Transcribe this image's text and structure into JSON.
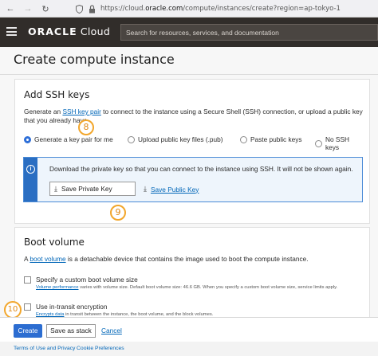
{
  "browser": {
    "url_prefix": "https://cloud.",
    "url_host": "oracle.com",
    "url_path": "/compute/instances/create?region=ap-tokyo-1"
  },
  "header": {
    "logo_bold": "ORACLE",
    "logo_light": " Cloud",
    "search_placeholder": "Search for resources, services, and documentation"
  },
  "page": {
    "title": "Create compute instance"
  },
  "ssh": {
    "title": "Add SSH keys",
    "desc_before": "Generate an ",
    "desc_link": "SSH key pair",
    "desc_after": " to connect to the instance using a Secure Shell (SSH) connection, or upload a public key that you already have.",
    "options": [
      {
        "label": "Generate a key pair for me",
        "selected": true
      },
      {
        "label": "Upload public key files (.pub)",
        "selected": false
      },
      {
        "label": "Paste public keys",
        "selected": false
      },
      {
        "label": "No SSH keys",
        "selected": false
      }
    ],
    "info_text": "Download the private key so that you can connect to the instance using SSH. It will not be shown again.",
    "save_private_label": "Save Private Key",
    "save_public_label": "Save Public Key"
  },
  "boot": {
    "title": "Boot volume",
    "desc_before": "A ",
    "desc_link": "boot volume",
    "desc_after": " is a detachable device that contains the image used to boot the compute instance.",
    "custom_size_label": "Specify a custom boot volume size",
    "custom_size_help_link": "Volume performance",
    "custom_size_help": " varies with volume size. Default boot volume size: 46.6 GB. When you specify a custom boot volume size, service limits apply.",
    "transit_label": "Use in-transit encryption",
    "transit_help_link": "Encrypts data",
    "transit_help": " in transit between the instance, the boot volume, and the block volumes."
  },
  "markers": {
    "m8": "8",
    "m9": "9",
    "m10": "10"
  },
  "footer": {
    "create_label": "Create",
    "stack_label": "Save as stack",
    "cancel_label": "Cancel"
  },
  "legal": {
    "terms": "Terms of Use and Privacy",
    "cookies": "Cookie Preferences"
  },
  "colors": {
    "primary": "#2c6dd1",
    "link": "#0066b8",
    "header_bg": "#312d2a",
    "marker": "#f2a62b"
  }
}
